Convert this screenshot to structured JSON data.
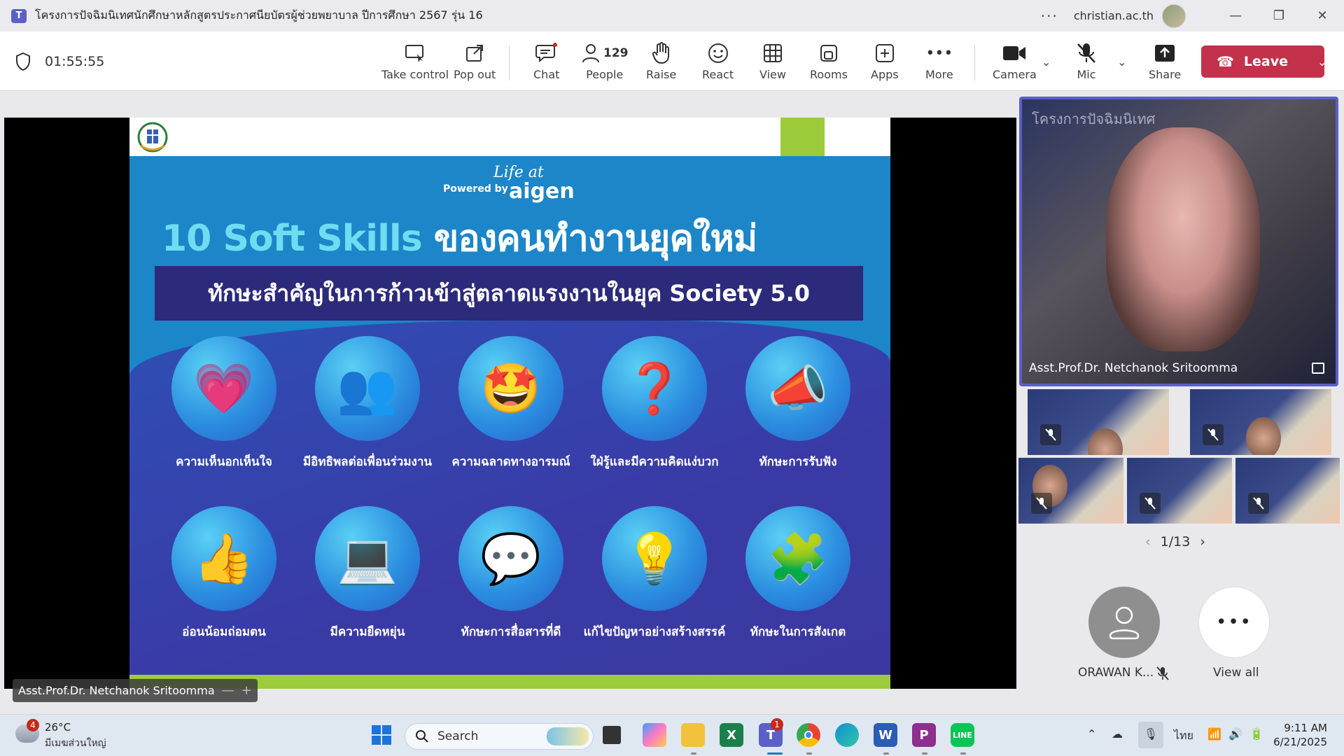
{
  "window": {
    "title": "โครงการปัจฉิมนิเทศนักศึกษาหลักสูตรประกาศนียบัตรผู้ช่วยพยาบาล ปีการศึกษา 2567 รุ่น 16",
    "account": "christian.ac.th",
    "more_dots": "···"
  },
  "meeting": {
    "timer": "01:55:55",
    "people_count": "129",
    "buttons": {
      "take_control": "Take control",
      "pop_out": "Pop out",
      "chat": "Chat",
      "people": "People",
      "raise": "Raise",
      "react": "React",
      "view": "View",
      "rooms": "Rooms",
      "apps": "Apps",
      "more": "More",
      "camera": "Camera",
      "mic": "Mic",
      "share": "Share",
      "leave": "Leave"
    }
  },
  "slide": {
    "life_at": "Life at",
    "powered_by": "Powered by",
    "brand": "aigen",
    "headline_a": "10 Soft Skills",
    "headline_b": " ของคนทำงานยุคใหม่",
    "subheading": "ทักษะสำคัญในการก้าวเข้าสู่ตลาดแรงงานในยุค Society 5.0",
    "skills": [
      {
        "label": "ความเห็นอกเห็นใจ",
        "icon": "hearts-icon"
      },
      {
        "label": "มีอิทธิพลต่อเพื่อนร่วมงาน",
        "icon": "coworkers-icon"
      },
      {
        "label": "ความฉลาดทางอารมณ์",
        "icon": "star-eyes-emoji-icon"
      },
      {
        "label": "ใฝ่รู้และมีความคิดแง่บวก",
        "icon": "question-bubbles-icon"
      },
      {
        "label": "ทักษะการรับฟัง",
        "icon": "megaphone-icon"
      },
      {
        "label": "อ่อนน้อมถ่อมตน",
        "icon": "thumbs-up-icon"
      },
      {
        "label": "มีความยืดหยุ่น",
        "icon": "person-laptop-icon"
      },
      {
        "label": "ทักษะการสื่อสารที่ดี",
        "icon": "chat-bubbles-icon"
      },
      {
        "label": "แก้ไขปัญหาอย่างสร้างสรรค์",
        "icon": "lightbulb-icon"
      },
      {
        "label": "ทักษะในการสังเกต",
        "icon": "puzzle-icon"
      }
    ]
  },
  "stage": {
    "presenter_label": "Asst.Prof.Dr. Netchanok Sritoomma",
    "minus": "—",
    "plus": "+"
  },
  "panel": {
    "spotlight_name": "Asst.Prof.Dr. Netchanok Sritoomma",
    "spotlight_banner": "โครงการปัจฉิมนิเทศ",
    "pager": "1/13",
    "participant_name": "ORAWAN K...",
    "view_all": "View all"
  },
  "taskbar": {
    "weather_badge": "4",
    "temperature": "26°C",
    "weather_condition": "มีเมฆส่วนใหญ่",
    "search_placeholder": "Search",
    "teams_badge": "1",
    "language": "ไทย",
    "time": "9:11 AM",
    "date": "6/21/2025"
  },
  "colors": {
    "accent": "#5b5fc7",
    "leave": "#c4314b",
    "slide_blue": "#1c86c8",
    "slide_green": "#9ccc3c"
  }
}
